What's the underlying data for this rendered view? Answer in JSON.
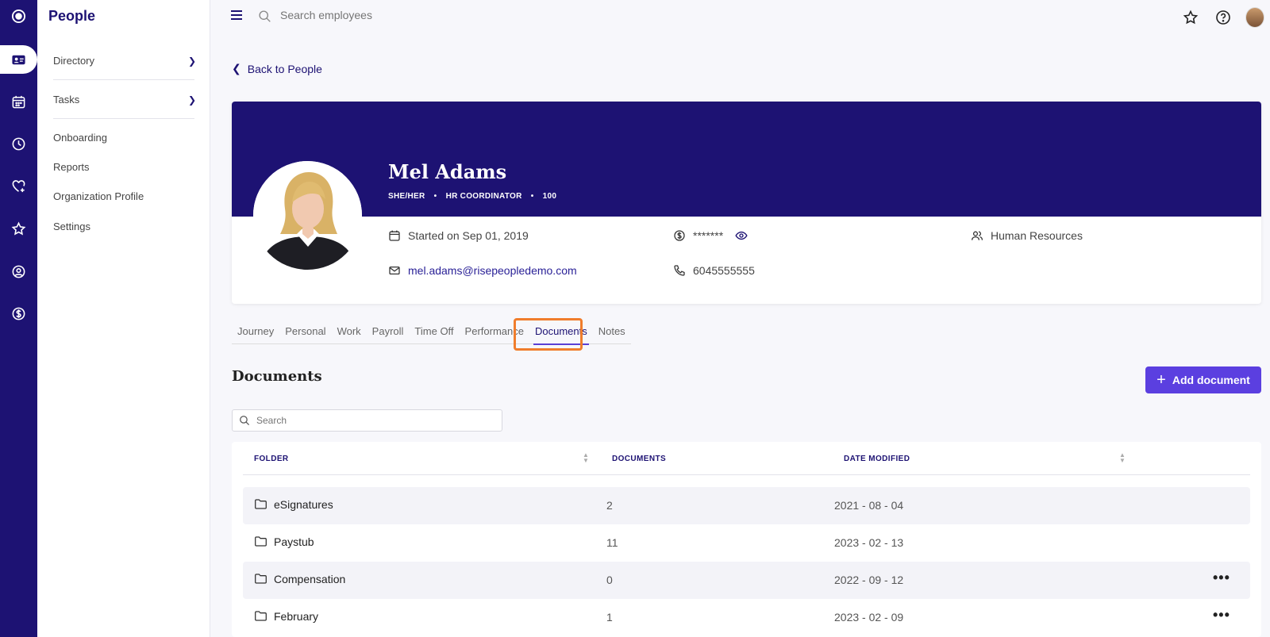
{
  "rail": {
    "icons": [
      "logo-icon",
      "id-card-icon",
      "calendar-icon",
      "clock-icon",
      "heart-icon",
      "star-icon",
      "search-person-icon",
      "dollar-icon"
    ]
  },
  "sidebar": {
    "title": "People",
    "items": [
      {
        "label": "Directory"
      },
      {
        "label": "Tasks"
      },
      {
        "label": "Onboarding"
      },
      {
        "label": "Reports"
      },
      {
        "label": "Organization Profile"
      },
      {
        "label": "Settings"
      }
    ]
  },
  "topbar": {
    "search_placeholder": "Search employees"
  },
  "back_link": "Back to People",
  "profile": {
    "name": "Mel Adams",
    "pronouns": "SHE/HER",
    "title": "HR COORDINATOR",
    "id": "100",
    "start": "Started on Sep 01, 2019",
    "salary": "*******",
    "department": "Human Resources",
    "email": "mel.adams@risepeopledemo.com",
    "phone": "6045555555"
  },
  "tabs": [
    "Journey",
    "Personal",
    "Work",
    "Payroll",
    "Time Off",
    "Performance",
    "Documents",
    "Notes"
  ],
  "active_tab": "Documents",
  "documents": {
    "title": "Documents",
    "add_label": "Add document",
    "search_placeholder": "Search",
    "headers": {
      "folder": "FOLDER",
      "documents": "DOCUMENTS",
      "date_modified": "DATE MODIFIED"
    },
    "rows": [
      {
        "folder": "eSignatures",
        "count": "2",
        "date": "2021 - 08 - 04",
        "more": false
      },
      {
        "folder": "Paystub",
        "count": "11",
        "date": "2023 - 02 - 13",
        "more": false
      },
      {
        "folder": "Compensation",
        "count": "0",
        "date": "2022 - 09 - 12",
        "more": true
      },
      {
        "folder": "February",
        "count": "1",
        "date": "2023 - 02 - 09",
        "more": true
      }
    ]
  },
  "colors": {
    "brand": "#1d1273",
    "accent": "#5b3fe0",
    "highlight": "#f07d2c"
  }
}
